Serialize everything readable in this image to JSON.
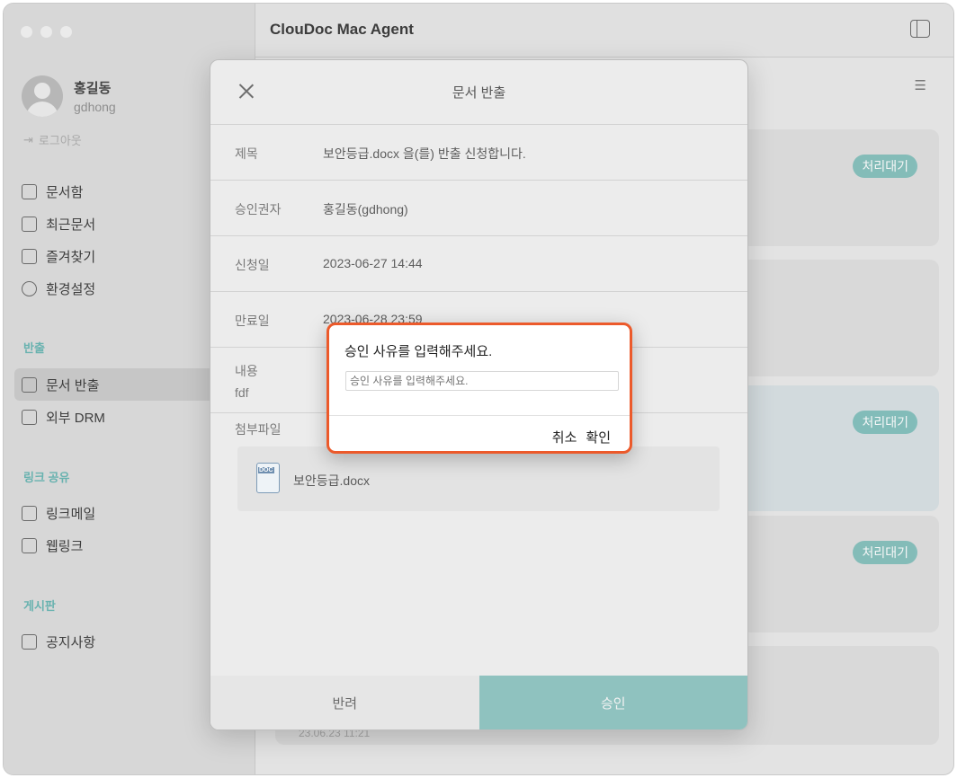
{
  "app": {
    "title": "ClouDoc Mac Agent"
  },
  "profile": {
    "name": "홍길동",
    "id": "gdhong",
    "logout": "로그아웃"
  },
  "nav": {
    "main": [
      {
        "label": "문서함",
        "icon": "folder-icon"
      },
      {
        "label": "최근문서",
        "icon": "recent-doc-icon"
      },
      {
        "label": "즐겨찾기",
        "icon": "favorite-doc-icon"
      },
      {
        "label": "환경설정",
        "icon": "gear-icon"
      }
    ],
    "export_section": "반출",
    "export": [
      {
        "label": "문서 반출",
        "icon": "export-icon",
        "active": true
      },
      {
        "label": "외부 DRM",
        "icon": "external-drm-icon"
      }
    ],
    "link_section": "링크 공유",
    "link": [
      {
        "label": "링크메일",
        "icon": "link-mail-icon"
      },
      {
        "label": "웹링크",
        "icon": "web-link-icon"
      }
    ],
    "board_section": "게시판",
    "board": [
      {
        "label": "공지사항",
        "icon": "megaphone-icon"
      }
    ]
  },
  "cards": [
    {
      "status": "처리대기"
    },
    {
      "status": ""
    },
    {
      "status": "처리대기"
    },
    {
      "status": "처리대기"
    },
    {
      "status": "",
      "date": "23.06.23 11:21"
    }
  ],
  "modal": {
    "title": "문서 반출",
    "fields": [
      {
        "key": "제목",
        "value": "보안등급.docx 을(를) 반출 신청합니다."
      },
      {
        "key": "승인권자",
        "value": "홍길동(gdhong)"
      },
      {
        "key": "신청일",
        "value": "2023-06-27 14:44"
      },
      {
        "key": "만료일",
        "value": "2023-06-28 23:59"
      }
    ],
    "content_label": "내용",
    "content_value": "fdf",
    "attachment_label": "첨부파일",
    "file_name": "보안등급.docx",
    "file_tag": "DOC",
    "reject_label": "반려",
    "approve_label": "승인"
  },
  "prompt": {
    "title": "승인 사유를 입력해주세요.",
    "placeholder": "승인 사유를 입력해주세요.",
    "cancel_label": "취소",
    "confirm_label": "확인"
  }
}
